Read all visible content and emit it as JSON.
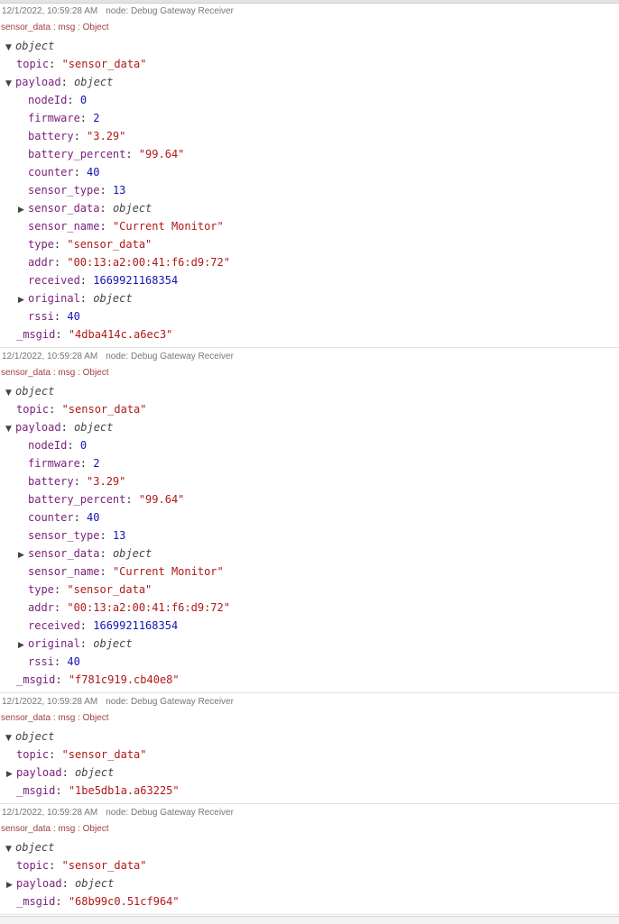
{
  "messages": [
    {
      "timestamp": "12/1/2022, 10:59:28 AM",
      "node": "node: Debug Gateway Receiver",
      "topic_line": "sensor_data : msg : Object",
      "root_label": "object",
      "topic_key": "topic",
      "topic_value": "\"sensor_data\"",
      "payload_key": "payload",
      "payload_type": "object",
      "payload_expanded": true,
      "fields": {
        "nodeId": "0",
        "firmware": "2",
        "battery": "\"3.29\"",
        "battery_percent": "\"99.64\"",
        "counter": "40",
        "sensor_type": "13",
        "sensor_data": "object",
        "sensor_name": "\"Current Monitor\"",
        "type": "\"sensor_data\"",
        "addr": "\"00:13:a2:00:41:f6:d9:72\"",
        "received": "1669921168354",
        "original": "object",
        "rssi": "40"
      },
      "msgid_key": "_msgid",
      "msgid_value": "\"4dba414c.a6ec3\""
    },
    {
      "timestamp": "12/1/2022, 10:59:28 AM",
      "node": "node: Debug Gateway Receiver",
      "topic_line": "sensor_data : msg : Object",
      "root_label": "object",
      "topic_key": "topic",
      "topic_value": "\"sensor_data\"",
      "payload_key": "payload",
      "payload_type": "object",
      "payload_expanded": true,
      "fields": {
        "nodeId": "0",
        "firmware": "2",
        "battery": "\"3.29\"",
        "battery_percent": "\"99.64\"",
        "counter": "40",
        "sensor_type": "13",
        "sensor_data": "object",
        "sensor_name": "\"Current Monitor\"",
        "type": "\"sensor_data\"",
        "addr": "\"00:13:a2:00:41:f6:d9:72\"",
        "received": "1669921168354",
        "original": "object",
        "rssi": "40"
      },
      "msgid_key": "_msgid",
      "msgid_value": "\"f781c919.cb40e8\""
    },
    {
      "timestamp": "12/1/2022, 10:59:28 AM",
      "node": "node: Debug Gateway Receiver",
      "topic_line": "sensor_data : msg : Object",
      "root_label": "object",
      "topic_key": "topic",
      "topic_value": "\"sensor_data\"",
      "payload_key": "payload",
      "payload_type": "object",
      "payload_expanded": false,
      "msgid_key": "_msgid",
      "msgid_value": "\"1be5db1a.a63225\""
    },
    {
      "timestamp": "12/1/2022, 10:59:28 AM",
      "node": "node: Debug Gateway Receiver",
      "topic_line": "sensor_data : msg : Object",
      "root_label": "object",
      "topic_key": "topic",
      "topic_value": "\"sensor_data\"",
      "payload_key": "payload",
      "payload_type": "object",
      "payload_expanded": false,
      "msgid_key": "_msgid",
      "msgid_value": "\"68b99c0.51cf964\""
    }
  ]
}
